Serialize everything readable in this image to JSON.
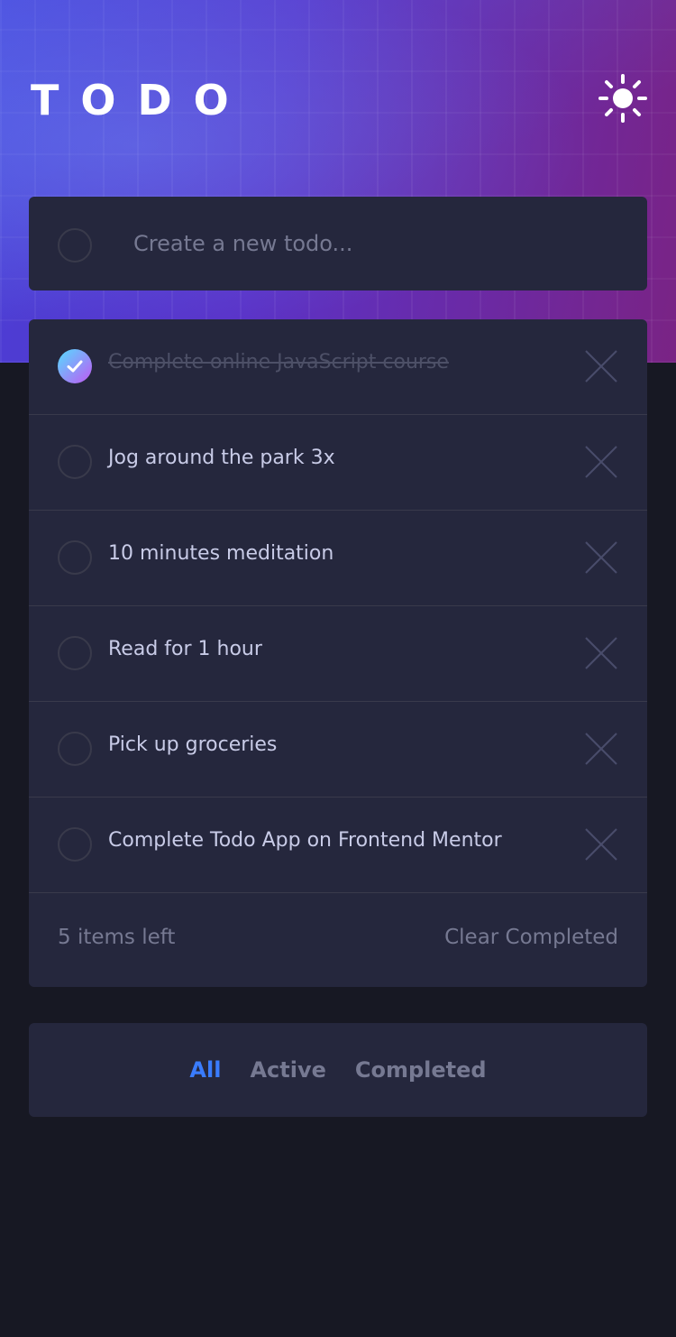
{
  "app": {
    "title": "TODO"
  },
  "new_todo": {
    "placeholder": "Create a new todo..."
  },
  "todos": [
    {
      "text": "Complete online JavaScript course",
      "completed": true
    },
    {
      "text": "Jog around the park 3x",
      "completed": false
    },
    {
      "text": "10 minutes meditation",
      "completed": false
    },
    {
      "text": "Read for 1 hour",
      "completed": false
    },
    {
      "text": "Pick up groceries",
      "completed": false
    },
    {
      "text": "Complete Todo App on Frontend Mentor",
      "completed": false
    }
  ],
  "footer": {
    "items_left": "5 items left",
    "clear_label": "Clear Completed"
  },
  "filters": {
    "all": "All",
    "active": "Active",
    "completed": "Completed",
    "selected": "All"
  },
  "colors": {
    "accent": "#3a7cfd",
    "card": "#25273d",
    "background": "#171823"
  },
  "icons": {
    "theme": "sun-icon",
    "delete": "close-icon",
    "check": "check-icon"
  }
}
